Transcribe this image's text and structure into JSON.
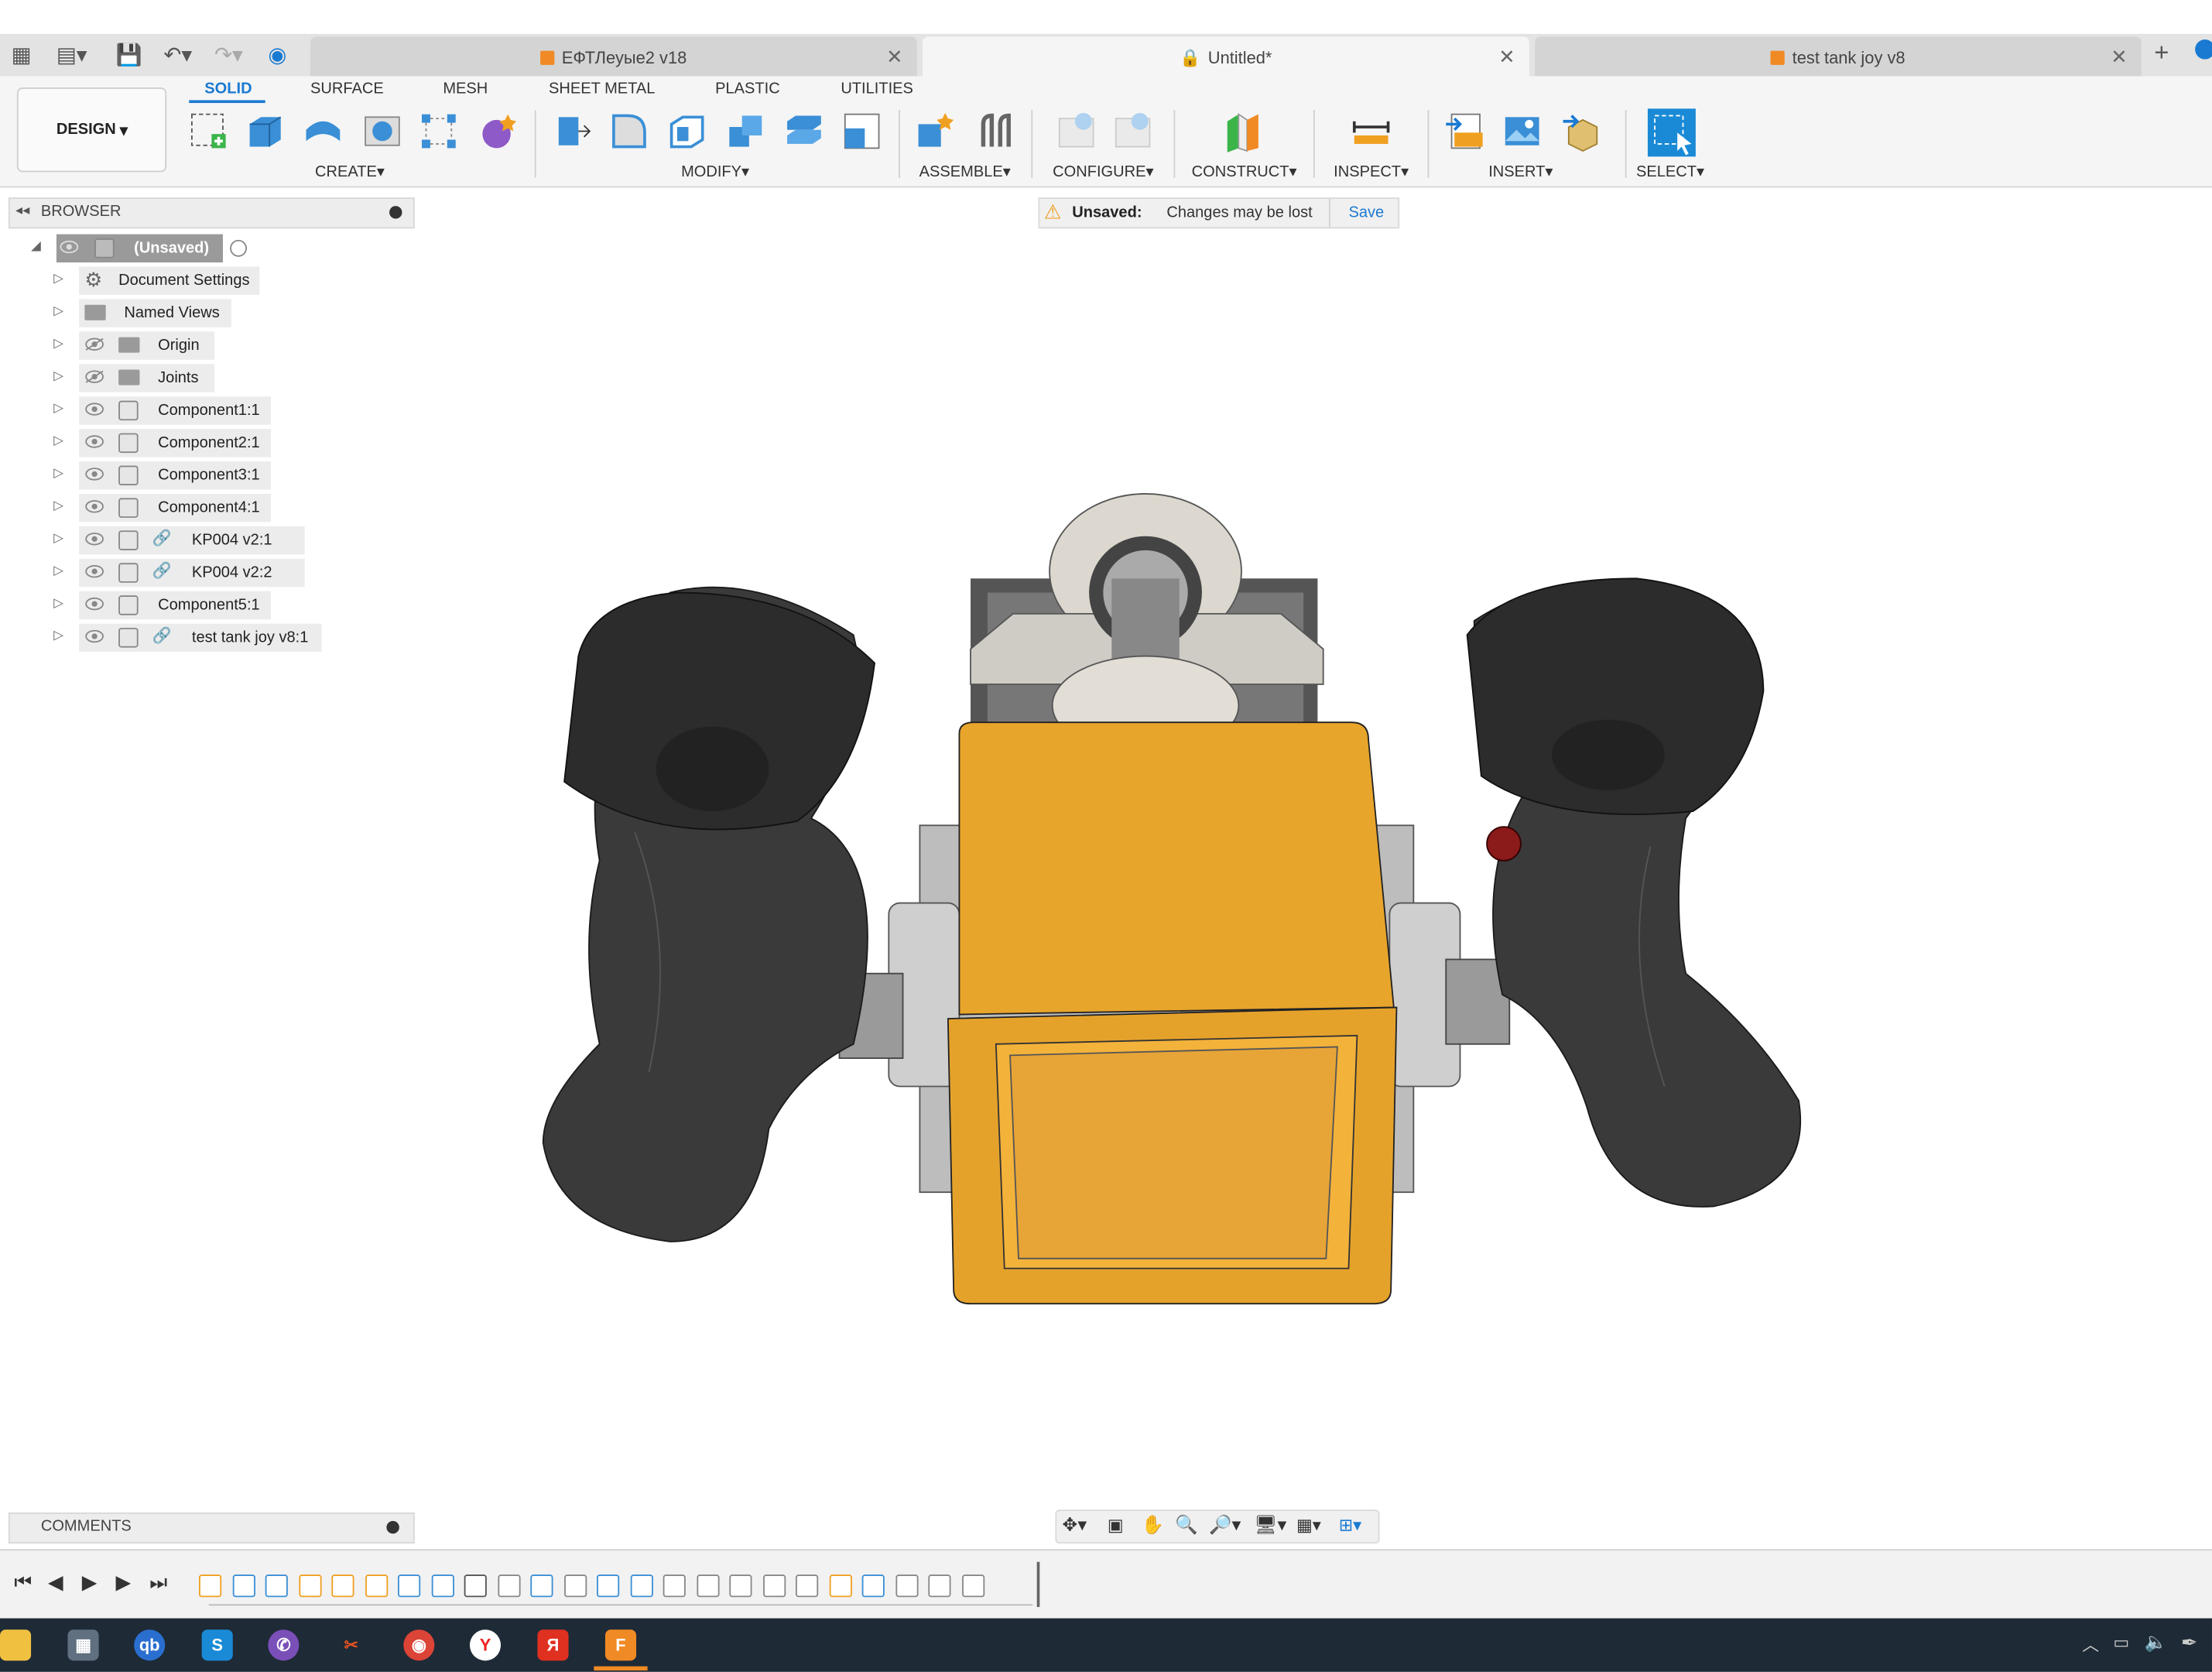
{
  "tabs": [
    {
      "label": "ЕФТЛеуые2 v18",
      "active": false
    },
    {
      "label": "Untitled*",
      "active": true
    },
    {
      "label": "test tank joy v8",
      "active": false
    }
  ],
  "workspace": {
    "label": "DESIGN"
  },
  "ribbon_tabs": [
    "SOLID",
    "SURFACE",
    "MESH",
    "SHEET METAL",
    "PLASTIC",
    "UTILITIES"
  ],
  "ribbon_groups": [
    "CREATE",
    "MODIFY",
    "ASSEMBLE",
    "CONFIGURE",
    "CONSTRUCT",
    "INSPECT",
    "INSERT",
    "SELECT"
  ],
  "browser": {
    "title": "BROWSER",
    "root": "(Unsaved)",
    "items": [
      {
        "label": "Document Settings",
        "icon": "gear-icon"
      },
      {
        "label": "Named Views",
        "icon": "folder-icon"
      },
      {
        "label": "Origin",
        "icon": "folder-icon",
        "hidden": true
      },
      {
        "label": "Joints",
        "icon": "folder-icon",
        "hidden": true
      },
      {
        "label": "Component1:1",
        "icon": "component-icon"
      },
      {
        "label": "Component2:1",
        "icon": "component-icon"
      },
      {
        "label": "Component3:1",
        "icon": "component-icon"
      },
      {
        "label": "Component4:1",
        "icon": "component-icon"
      },
      {
        "label": "KP004 v2:1",
        "icon": "linked-component-icon"
      },
      {
        "label": "KP004 v2:2",
        "icon": "linked-component-icon"
      },
      {
        "label": "Component5:1",
        "icon": "component-icon"
      },
      {
        "label": "test tank joy v8:1",
        "icon": "linked-component-icon"
      }
    ]
  },
  "banner": {
    "prefix": "Unsaved:",
    "message": "Changes may be lost",
    "action": "Save"
  },
  "comments": {
    "title": "COMMENTS"
  },
  "colors": {
    "accent": "#1a7ad1",
    "body_orange": "#e8a52c",
    "grip_dark": "#3a3a3a",
    "warning": "#f0a020"
  }
}
